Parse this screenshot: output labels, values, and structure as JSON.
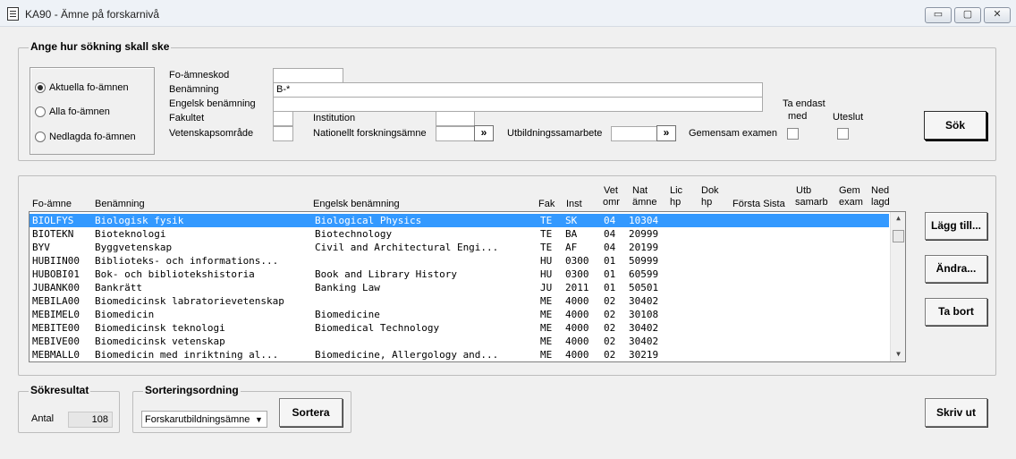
{
  "window": {
    "title": "KA90 - Ämne på forskarnivå",
    "controls": {
      "minimize": "▭",
      "maximize": "▢",
      "close": "✕"
    }
  },
  "search": {
    "legend": "Ange hur sökning skall ske",
    "radios": [
      {
        "label": "Aktuella fo-ämnen",
        "selected": true
      },
      {
        "label": "Alla fo-ämnen",
        "selected": false
      },
      {
        "label": "Nedlagda fo-ämnen",
        "selected": false
      }
    ],
    "fields": {
      "code_label": "Fo-ämneskod",
      "code_value": "",
      "name_label": "Benämning",
      "name_value": "B-*",
      "eng_label": "Engelsk benämning",
      "eng_value": "",
      "fak_label": "Fakultet",
      "fak_value": "",
      "inst_label": "Institution",
      "inst_value": "",
      "vet_label": "Vetenskapsområde",
      "vet_value": "",
      "nat_label": "Nationellt forskningsämne",
      "nat_value": "",
      "utb_label": "Utbildningssamarbete",
      "utb_value": "",
      "gem_label": "Gemensam examen",
      "arrow": "»"
    },
    "ta_endast_line1": "Ta endast",
    "ta_endast_line2": "med",
    "uteslut": "Uteslut",
    "search_button": "Sök"
  },
  "table": {
    "headers": {
      "fo": "Fo-ämne",
      "ben": "Benämning",
      "eng": "Engelsk benämning",
      "fak": "Fak",
      "inst": "Inst",
      "vet1": "Vet",
      "vet2": "omr",
      "nat1": "Nat",
      "nat2": "ämne",
      "lic1": "Lic",
      "lic2": "hp",
      "dok1": "Dok",
      "dok2": "hp",
      "forsta_sista": "Första Sista",
      "utb1": "Utb",
      "utb2": "samarb",
      "gem1": "Gem",
      "gem2": "exam",
      "ned1": "Ned",
      "ned2": "lagd"
    },
    "rows": [
      {
        "fo": "BIOLFYS",
        "ben": "Biologisk fysik",
        "eng": "Biological Physics",
        "fak": "TE",
        "inst": "SK",
        "vet": "04",
        "nat": "10304",
        "selected": true
      },
      {
        "fo": "BIOTEKN",
        "ben": "Bioteknologi",
        "eng": "Biotechnology",
        "fak": "TE",
        "inst": "BA",
        "vet": "04",
        "nat": "20999",
        "selected": false
      },
      {
        "fo": "BYV",
        "ben": "Byggvetenskap",
        "eng": "Civil and Architectural Engi...",
        "fak": "TE",
        "inst": "AF",
        "vet": "04",
        "nat": "20199",
        "selected": false
      },
      {
        "fo": "HUBIIN00",
        "ben": "Biblioteks- och informations...",
        "eng": "",
        "fak": "HU",
        "inst": "0300",
        "vet": "01",
        "nat": "50999",
        "selected": false
      },
      {
        "fo": "HUBOBI01",
        "ben": "Bok- och bibliotekshistoria",
        "eng": "Book and Library History",
        "fak": "HU",
        "inst": "0300",
        "vet": "01",
        "nat": "60599",
        "selected": false
      },
      {
        "fo": "JUBANK00",
        "ben": "Bankrätt",
        "eng": "Banking Law",
        "fak": "JU",
        "inst": "2011",
        "vet": "01",
        "nat": "50501",
        "selected": false
      },
      {
        "fo": "MEBILA00",
        "ben": "Biomedicinsk labratorievetenskap",
        "eng": "",
        "fak": "ME",
        "inst": "4000",
        "vet": "02",
        "nat": "30402",
        "selected": false
      },
      {
        "fo": "MEBIMEL0",
        "ben": "Biomedicin",
        "eng": "Biomedicine",
        "fak": "ME",
        "inst": "4000",
        "vet": "02",
        "nat": "30108",
        "selected": false
      },
      {
        "fo": "MEBITE00",
        "ben": "Biomedicinsk teknologi",
        "eng": "Biomedical Technology",
        "fak": "ME",
        "inst": "4000",
        "vet": "02",
        "nat": "30402",
        "selected": false
      },
      {
        "fo": "MEBIVE00",
        "ben": "Biomedicinsk vetenskap",
        "eng": "",
        "fak": "ME",
        "inst": "4000",
        "vet": "02",
        "nat": "30402",
        "selected": false
      },
      {
        "fo": "MEBMALL0",
        "ben": "Biomedicin med inriktning al...",
        "eng": "Biomedicine, Allergology and...",
        "fak": "ME",
        "inst": "4000",
        "vet": "02",
        "nat": "30219",
        "selected": false
      }
    ]
  },
  "buttons": {
    "add": "Lägg till...",
    "edit": "Ändra...",
    "delete": "Ta bort",
    "print": "Skriv ut"
  },
  "result": {
    "legend": "Sökresultat",
    "count_label": "Antal",
    "count_value": "108"
  },
  "sort": {
    "legend": "Sorteringsordning",
    "selected": "Forskarutbildningsämne",
    "button": "Sortera"
  }
}
